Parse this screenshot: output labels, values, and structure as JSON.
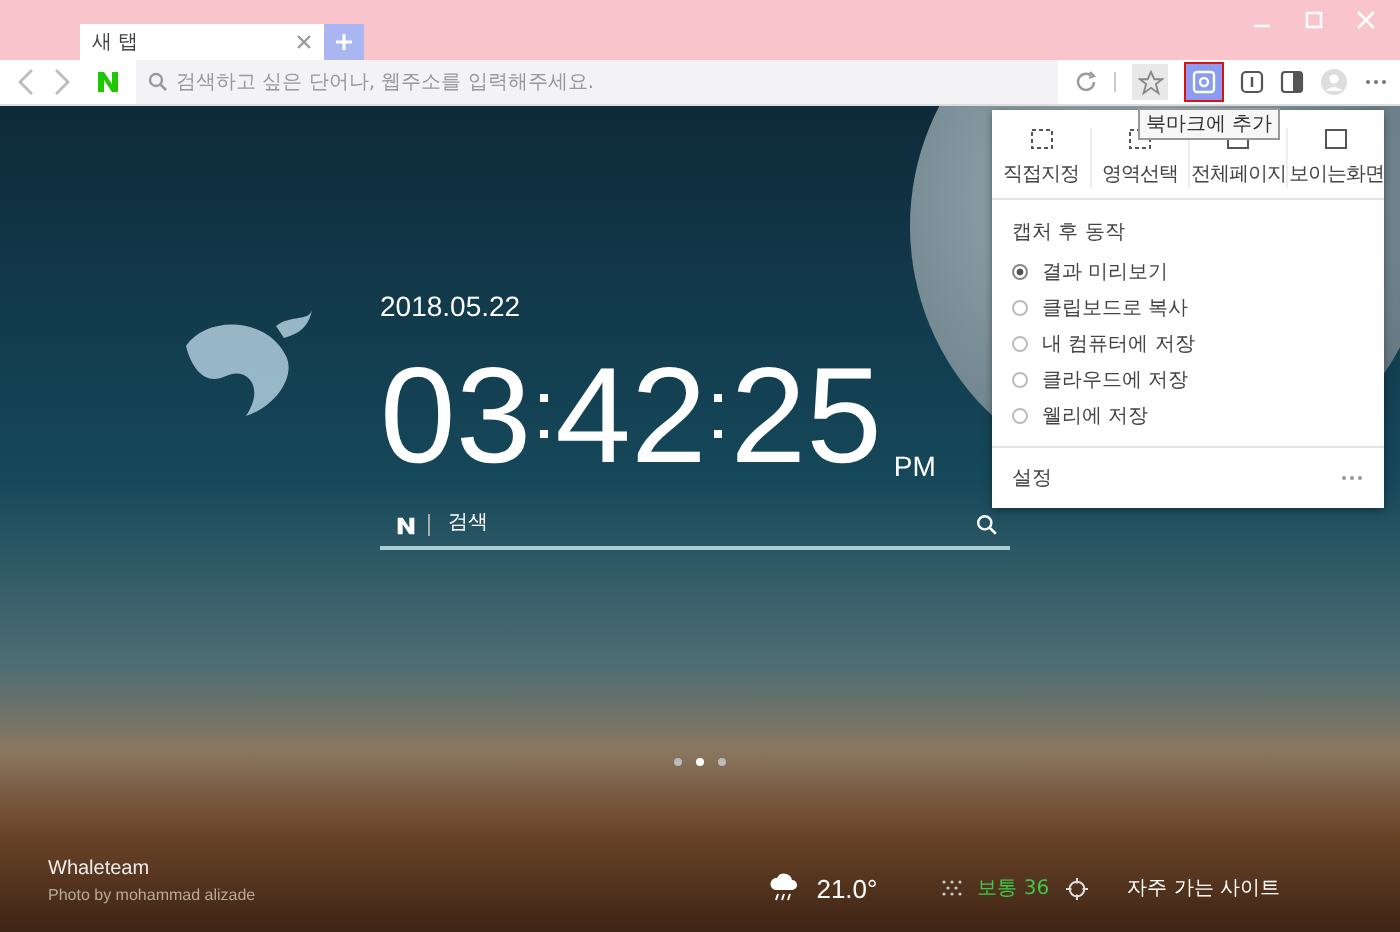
{
  "tabs": [
    {
      "label": "새 탭",
      "selected": true
    }
  ],
  "address_bar": {
    "placeholder": "검색하고 싶은 단어나, 웹주소를 입력해주세요."
  },
  "toolbar": {
    "capture_highlighted": true,
    "tooltip": "북마크에 추가"
  },
  "capture_menu": {
    "modes": [
      {
        "label": "직접지정"
      },
      {
        "label": "영역선택"
      },
      {
        "label": "전체페이지"
      },
      {
        "label": "보이는화면"
      }
    ],
    "after_title": "캡처 후 동작",
    "options": [
      {
        "label": "결과 미리보기",
        "selected": true
      },
      {
        "label": "클립보드로 복사",
        "selected": false
      },
      {
        "label": "내 컴퓨터에 저장",
        "selected": false
      },
      {
        "label": "클라우드에 저장",
        "selected": false
      },
      {
        "label": "웰리에 저장",
        "selected": false
      }
    ],
    "settings_label": "설정"
  },
  "new_tab": {
    "date": "2018.05.22",
    "time": {
      "hours": "03",
      "minutes": "42",
      "seconds": "25",
      "ampm": "PM"
    },
    "search": {
      "placeholder": "검색"
    },
    "pager": [
      {
        "selected": false
      },
      {
        "selected": true
      },
      {
        "selected": false
      }
    ],
    "credit": {
      "title": "Whaleteam",
      "photo_by": "Photo by mohammad alizade"
    },
    "weather": {
      "temperature": "21.0°"
    },
    "air_quality": {
      "label": "보통 36"
    },
    "frequent_sites": "자주 가는 사이트"
  }
}
